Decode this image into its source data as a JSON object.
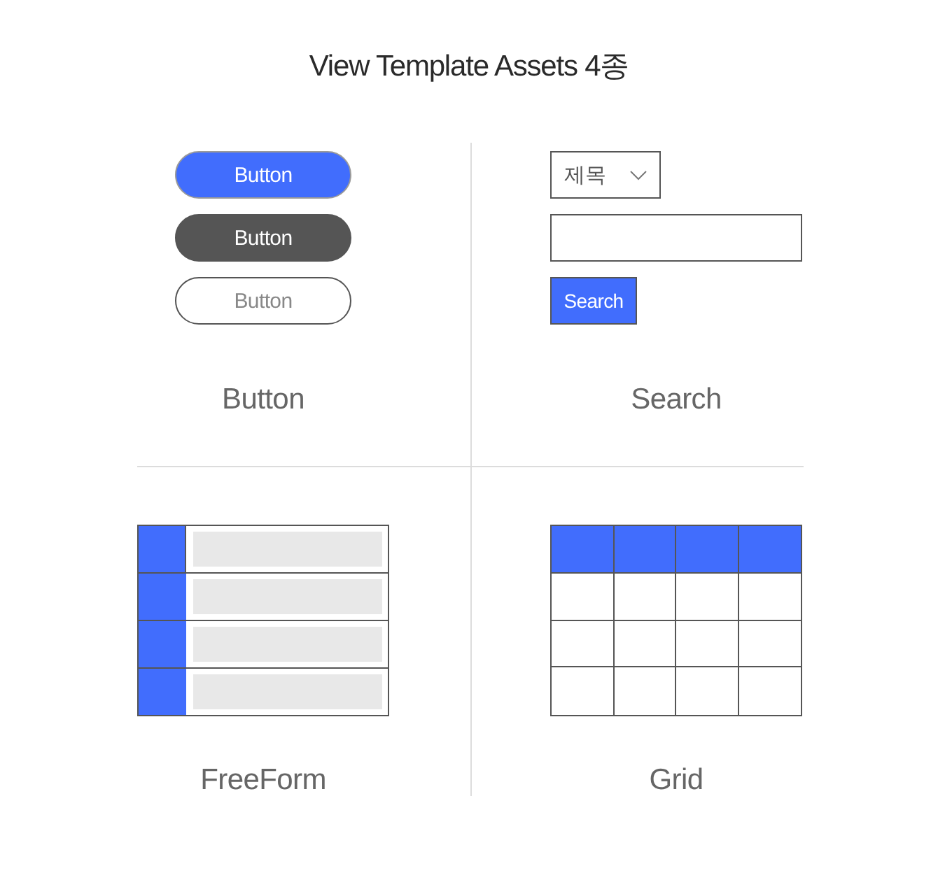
{
  "title": "View Template Assets 4종",
  "panels": [
    {
      "kind": "button",
      "label": "Button",
      "buttons": [
        {
          "label": "Button",
          "kind": "primary"
        },
        {
          "label": "Button",
          "kind": "dark"
        },
        {
          "label": "Button",
          "kind": "outline"
        }
      ]
    },
    {
      "kind": "search",
      "label": "Search",
      "select": {
        "value": "제목"
      },
      "button": {
        "label": "Search"
      }
    },
    {
      "kind": "freeform",
      "label": "FreeForm"
    },
    {
      "kind": "grid",
      "label": "Grid"
    }
  ]
}
